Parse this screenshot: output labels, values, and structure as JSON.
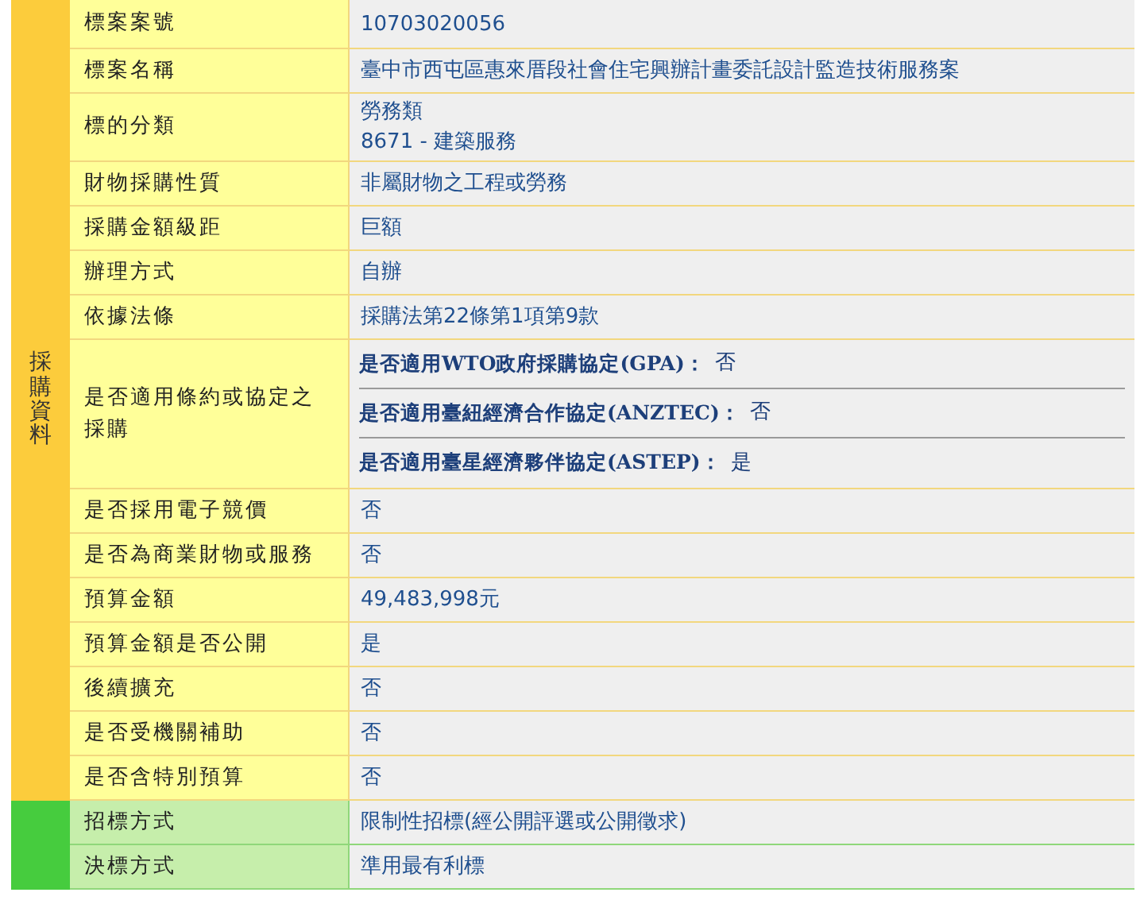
{
  "sections": [
    {
      "kind": "purchase",
      "title": "採購資料",
      "rows": [
        {
          "label": "標案案號",
          "values": [
            "10703020056"
          ]
        },
        {
          "label": "標案名稱",
          "values": [
            "臺中市西屯區惠來厝段社會住宅興辦計畫委託設計監造技術服務案"
          ]
        },
        {
          "label": "標的分類",
          "values": [
            "勞務類",
            "8671 - 建築服務"
          ]
        },
        {
          "label": "財物採購性質",
          "values": [
            "非屬財物之工程或勞務"
          ]
        },
        {
          "label": "採購金額級距",
          "values": [
            "巨額"
          ]
        },
        {
          "label": "辦理方式",
          "values": [
            "自辦"
          ]
        },
        {
          "label": "依據法條",
          "values": [
            "採購法第22條第1項第9款"
          ]
        },
        {
          "label": "是否適用條約或協定之採購",
          "kind": "agreements",
          "items": [
            {
              "question": "是否適用WTO政府採購協定(GPA)：",
              "answer": "否"
            },
            {
              "question": "是否適用臺紐經濟合作協定(ANZTEC)：",
              "answer": "否"
            },
            {
              "question": "是否適用臺星經濟夥伴協定(ASTEP)：",
              "answer": "是"
            }
          ]
        },
        {
          "label": "是否採用電子競價",
          "values": [
            "否"
          ]
        },
        {
          "label": "是否為商業財物或服務",
          "values": [
            "否"
          ]
        },
        {
          "label": "預算金額",
          "values": [
            "49,483,998元"
          ]
        },
        {
          "label": "預算金額是否公開",
          "values": [
            "是"
          ]
        },
        {
          "label": "後續擴充",
          "values": [
            "否"
          ]
        },
        {
          "label": "是否受機關補助",
          "values": [
            "否"
          ]
        },
        {
          "label": "是否含特別預算",
          "values": [
            "否"
          ]
        }
      ]
    },
    {
      "kind": "award",
      "rows": [
        {
          "label": "招標方式",
          "values": [
            "限制性招標(經公開評選或公開徵求)"
          ]
        },
        {
          "label": "決標方式",
          "values": [
            "準用最有利標"
          ]
        }
      ]
    }
  ]
}
